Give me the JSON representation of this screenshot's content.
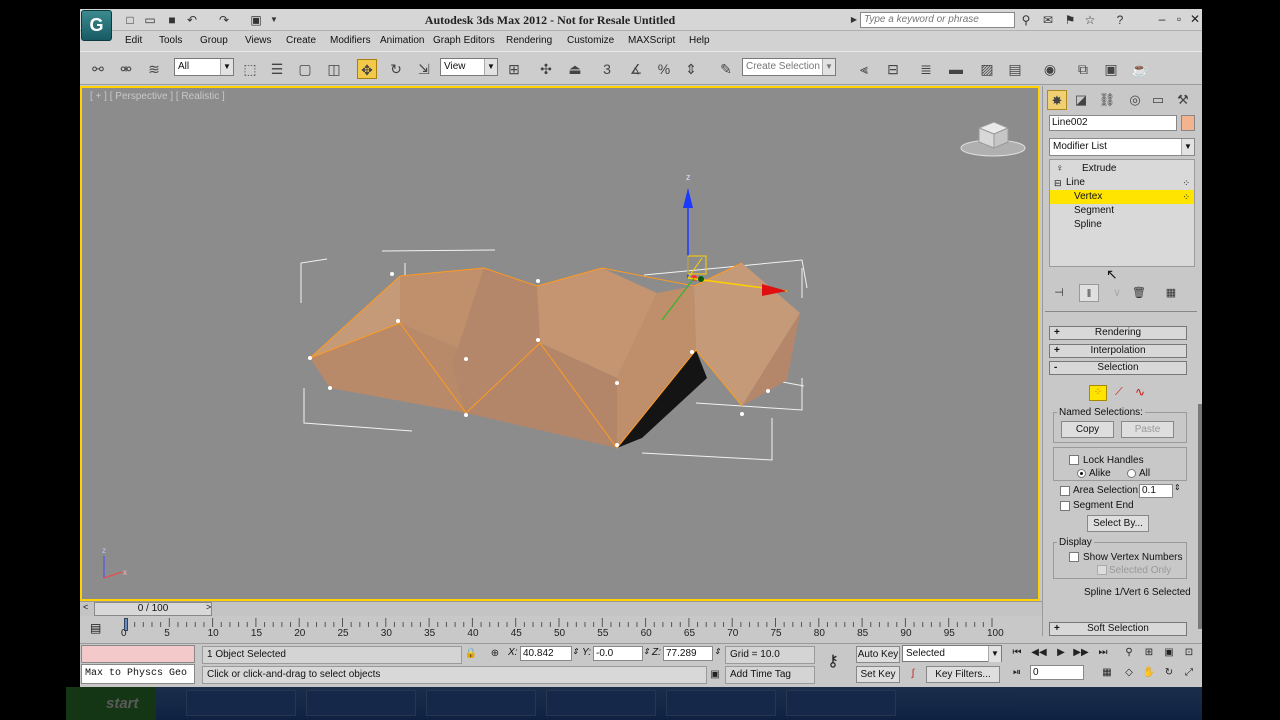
{
  "window": {
    "title": "Autodesk 3ds Max  2012  - Not for Resale    Untitled",
    "search_placeholder": "Type a keyword or phrase"
  },
  "menu": [
    "Edit",
    "Tools",
    "Group",
    "Views",
    "Create",
    "Modifiers",
    "Animation",
    "Graph Editors",
    "Rendering",
    "Customize",
    "MAXScript",
    "Help"
  ],
  "toolbar": {
    "selection_filter": "All",
    "ref_coord": "View",
    "named_selection_placeholder": "Create Selection Se"
  },
  "viewport": {
    "label": "[ + ] [ Perspective ] [ Realistic ]",
    "gizmo_z_label": "z",
    "axis_z_label": "z",
    "axis_x_label": "x"
  },
  "command_panel": {
    "object_name": "Line002",
    "object_color": "#f3b38e",
    "modifier_list": "Modifier List",
    "stack": [
      {
        "label": "Extrude",
        "selected": false
      },
      {
        "label": "Line",
        "selected": false
      },
      {
        "label": "Vertex",
        "selected": true
      },
      {
        "label": "Segment",
        "selected": false
      },
      {
        "label": "Spline",
        "selected": false
      }
    ],
    "rollouts": {
      "rendering": "Rendering",
      "interpolation": "Interpolation",
      "selection": "Selection",
      "soft_selection": "Soft Selection"
    },
    "rollout_signs": {
      "rendering": "+",
      "interpolation": "+",
      "selection": "-",
      "soft_selection": "+"
    },
    "selection": {
      "named_selections": "Named Selections:",
      "copy": "Copy",
      "paste": "Paste",
      "lock_handles": "Lock Handles",
      "alike": "Alike",
      "all": "All",
      "area_selection": "Area Selection:",
      "area_value": "0.1",
      "segment_end": "Segment End",
      "select_by": "Select By...",
      "display": "Display",
      "show_vertex_numbers": "Show Vertex Numbers",
      "selected_only": "Selected Only",
      "status": "Spline 1/Vert 6 Selected"
    }
  },
  "timeline": {
    "frame": "0 / 100",
    "ticks": [
      "0",
      "5",
      "10",
      "15",
      "20",
      "25",
      "30",
      "35",
      "40",
      "45",
      "50",
      "55",
      "60",
      "65",
      "70",
      "75",
      "80",
      "85",
      "90",
      "95",
      "100"
    ]
  },
  "status": {
    "script_output": "Max to Physcs Geo",
    "objects_selected": "1 Object Selected",
    "prompt": "Click or click-and-drag to select objects",
    "x_label": "X:",
    "x": "40.842",
    "y_label": "Y:",
    "y": "-0.0",
    "z_label": "Z:",
    "z": "77.289",
    "grid": "Grid = 10.0",
    "add_time_tag": "Add Time Tag",
    "auto_key": "Auto Key",
    "set_key": "Set Key",
    "key_mode": "Selected",
    "key_filters": "Key Filters...",
    "current_frame": "0"
  },
  "taskbar": {
    "start": "start"
  },
  "colors": {
    "viewport_border": "#ffd300",
    "selection_highlight": "#ffe400",
    "mesh": "#c49370"
  }
}
